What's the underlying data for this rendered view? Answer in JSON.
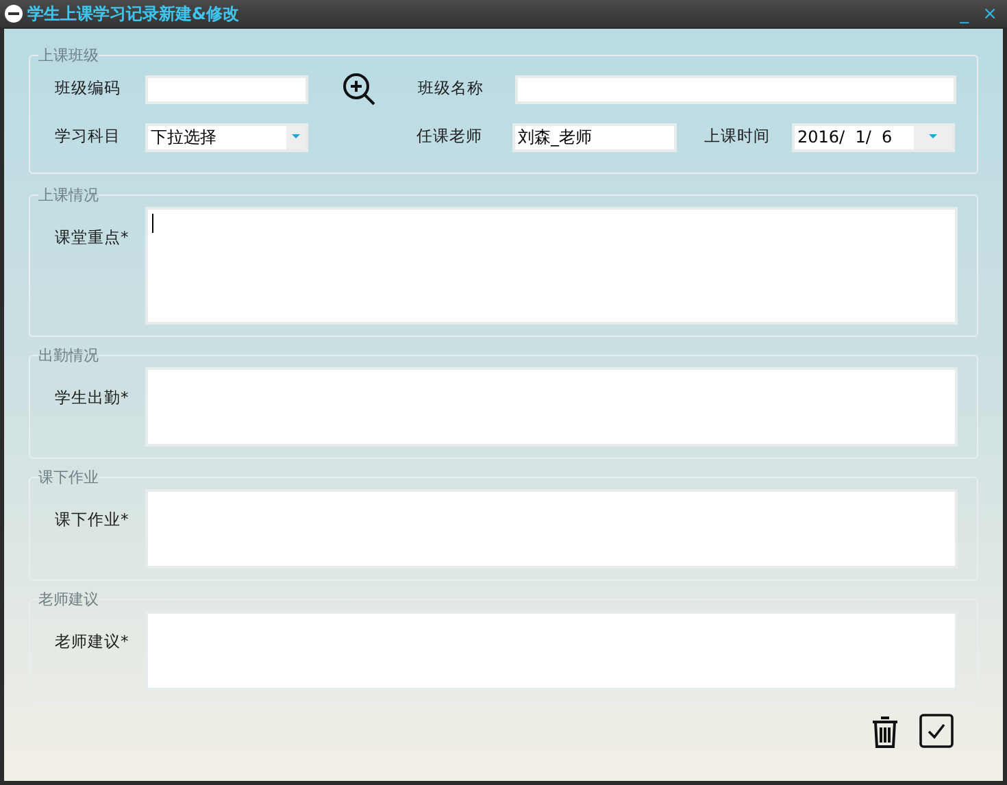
{
  "window": {
    "title": "学生上课学习记录新建&修改",
    "controls": [
      "_",
      "×"
    ]
  },
  "class_group": {
    "legend": "上课班级",
    "class_code": {
      "label": "班级编码"
    },
    "class_name": {
      "label": "班级名称"
    },
    "subject": {
      "label": "学习科目",
      "value": "下拉选择"
    },
    "teacher": {
      "label": "任课老师",
      "value": "刘森_老师"
    },
    "time": {
      "label": "上课时间",
      "value": "2016/  1/  6"
    }
  },
  "sections": [
    {
      "legend": "上课情况",
      "label": "课堂重点*",
      "focused": true
    },
    {
      "legend": "出勤情况",
      "label": "学生出勤*",
      "focused": false
    },
    {
      "legend": "课下作业",
      "label": "课下作业*",
      "focused": false
    },
    {
      "legend": "老师建议",
      "label": "老师建议*",
      "focused": false
    }
  ]
}
